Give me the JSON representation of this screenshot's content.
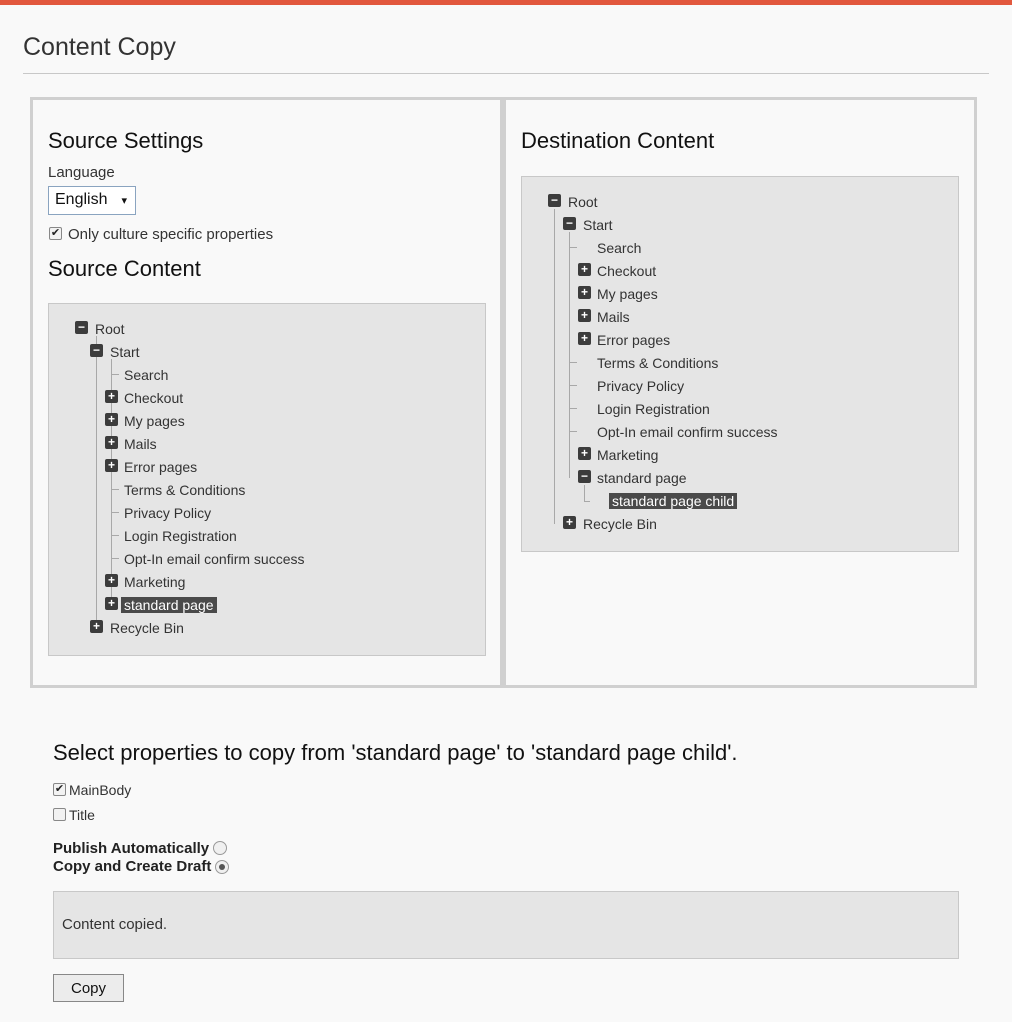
{
  "page": {
    "title": "Content Copy"
  },
  "source": {
    "heading": "Source Settings",
    "language_label": "Language",
    "language_value": "English",
    "culture_checkbox_label": "Only culture specific properties",
    "culture_checked": true,
    "content_heading": "Source Content",
    "tree": {
      "root": "Root",
      "start": "Start",
      "children": [
        "Search",
        "Checkout",
        "My pages",
        "Mails",
        "Error pages",
        "Terms & Conditions",
        "Privacy Policy",
        "Login Registration",
        "Opt-In email confirm success",
        "Marketing",
        "standard page"
      ],
      "recycle": "Recycle Bin",
      "selected": "standard page"
    }
  },
  "destination": {
    "heading": "Destination Content",
    "tree": {
      "root": "Root",
      "start": "Start",
      "children": [
        "Search",
        "Checkout",
        "My pages",
        "Mails",
        "Error pages",
        "Terms & Conditions",
        "Privacy Policy",
        "Login Registration",
        "Opt-In email confirm success",
        "Marketing",
        "standard page"
      ],
      "grandchild": "standard page child",
      "recycle": "Recycle Bin",
      "selected": "standard page child"
    }
  },
  "copy_section": {
    "title": "Select properties to copy from 'standard page' to 'standard page child'.",
    "properties": [
      {
        "label": "MainBody",
        "checked": true
      },
      {
        "label": "Title",
        "checked": false
      }
    ],
    "publish_label": "Publish Automatically",
    "draft_label": "Copy and Create Draft",
    "selected_mode": "Copy and Create Draft",
    "status": "Content copied.",
    "copy_button": "Copy"
  },
  "icons": {
    "check": "✔",
    "expand": "+",
    "collapse": "−",
    "dropdown": "▾"
  },
  "colors": {
    "accent": "#e2583e",
    "selection": "#4a4a4a",
    "tree_bg": "#e5e5e5"
  }
}
